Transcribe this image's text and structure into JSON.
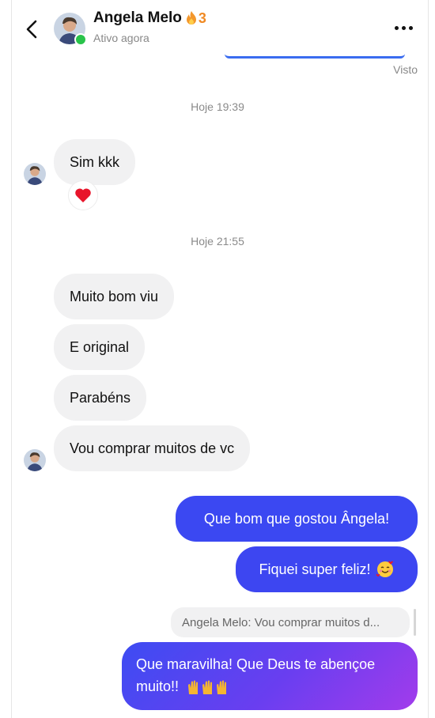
{
  "header": {
    "contact_name": "Angela Melo",
    "streak_count": "3",
    "status": "Ativo agora",
    "icons": {
      "back": "chevron-left-icon",
      "more": "more-horizontal-icon",
      "streak": "flame-icon"
    }
  },
  "seen_label": "Visto",
  "timestamps": [
    "Hoje 19:39",
    "Hoje 21:55"
  ],
  "messages_incoming": [
    {
      "text": "Sim kkk"
    },
    {
      "text": "Muito bom viu"
    },
    {
      "text": "E original"
    },
    {
      "text": "Parabéns"
    },
    {
      "text": "Vou comprar muitos de vc"
    }
  ],
  "reaction": {
    "icon": "heart-icon",
    "color": "#e8152b"
  },
  "messages_outgoing": [
    {
      "text": "Que bom que gostou Ângela!"
    },
    {
      "text": "Fiquei super feliz!",
      "emoji": "smiling-face-with-hearts-icon"
    }
  ],
  "reply": {
    "quote": "Angela Melo: Vou comprar muitos d...",
    "text_line1": "Que maravilha! Que Deus te abençoe",
    "text_line2": "muito!!",
    "emoji": "raised-hands-icon"
  },
  "colors": {
    "outgoing": "#3b48f2",
    "incoming": "#f1f1f2",
    "online": "#29c34a",
    "streak": "#f08a24"
  }
}
